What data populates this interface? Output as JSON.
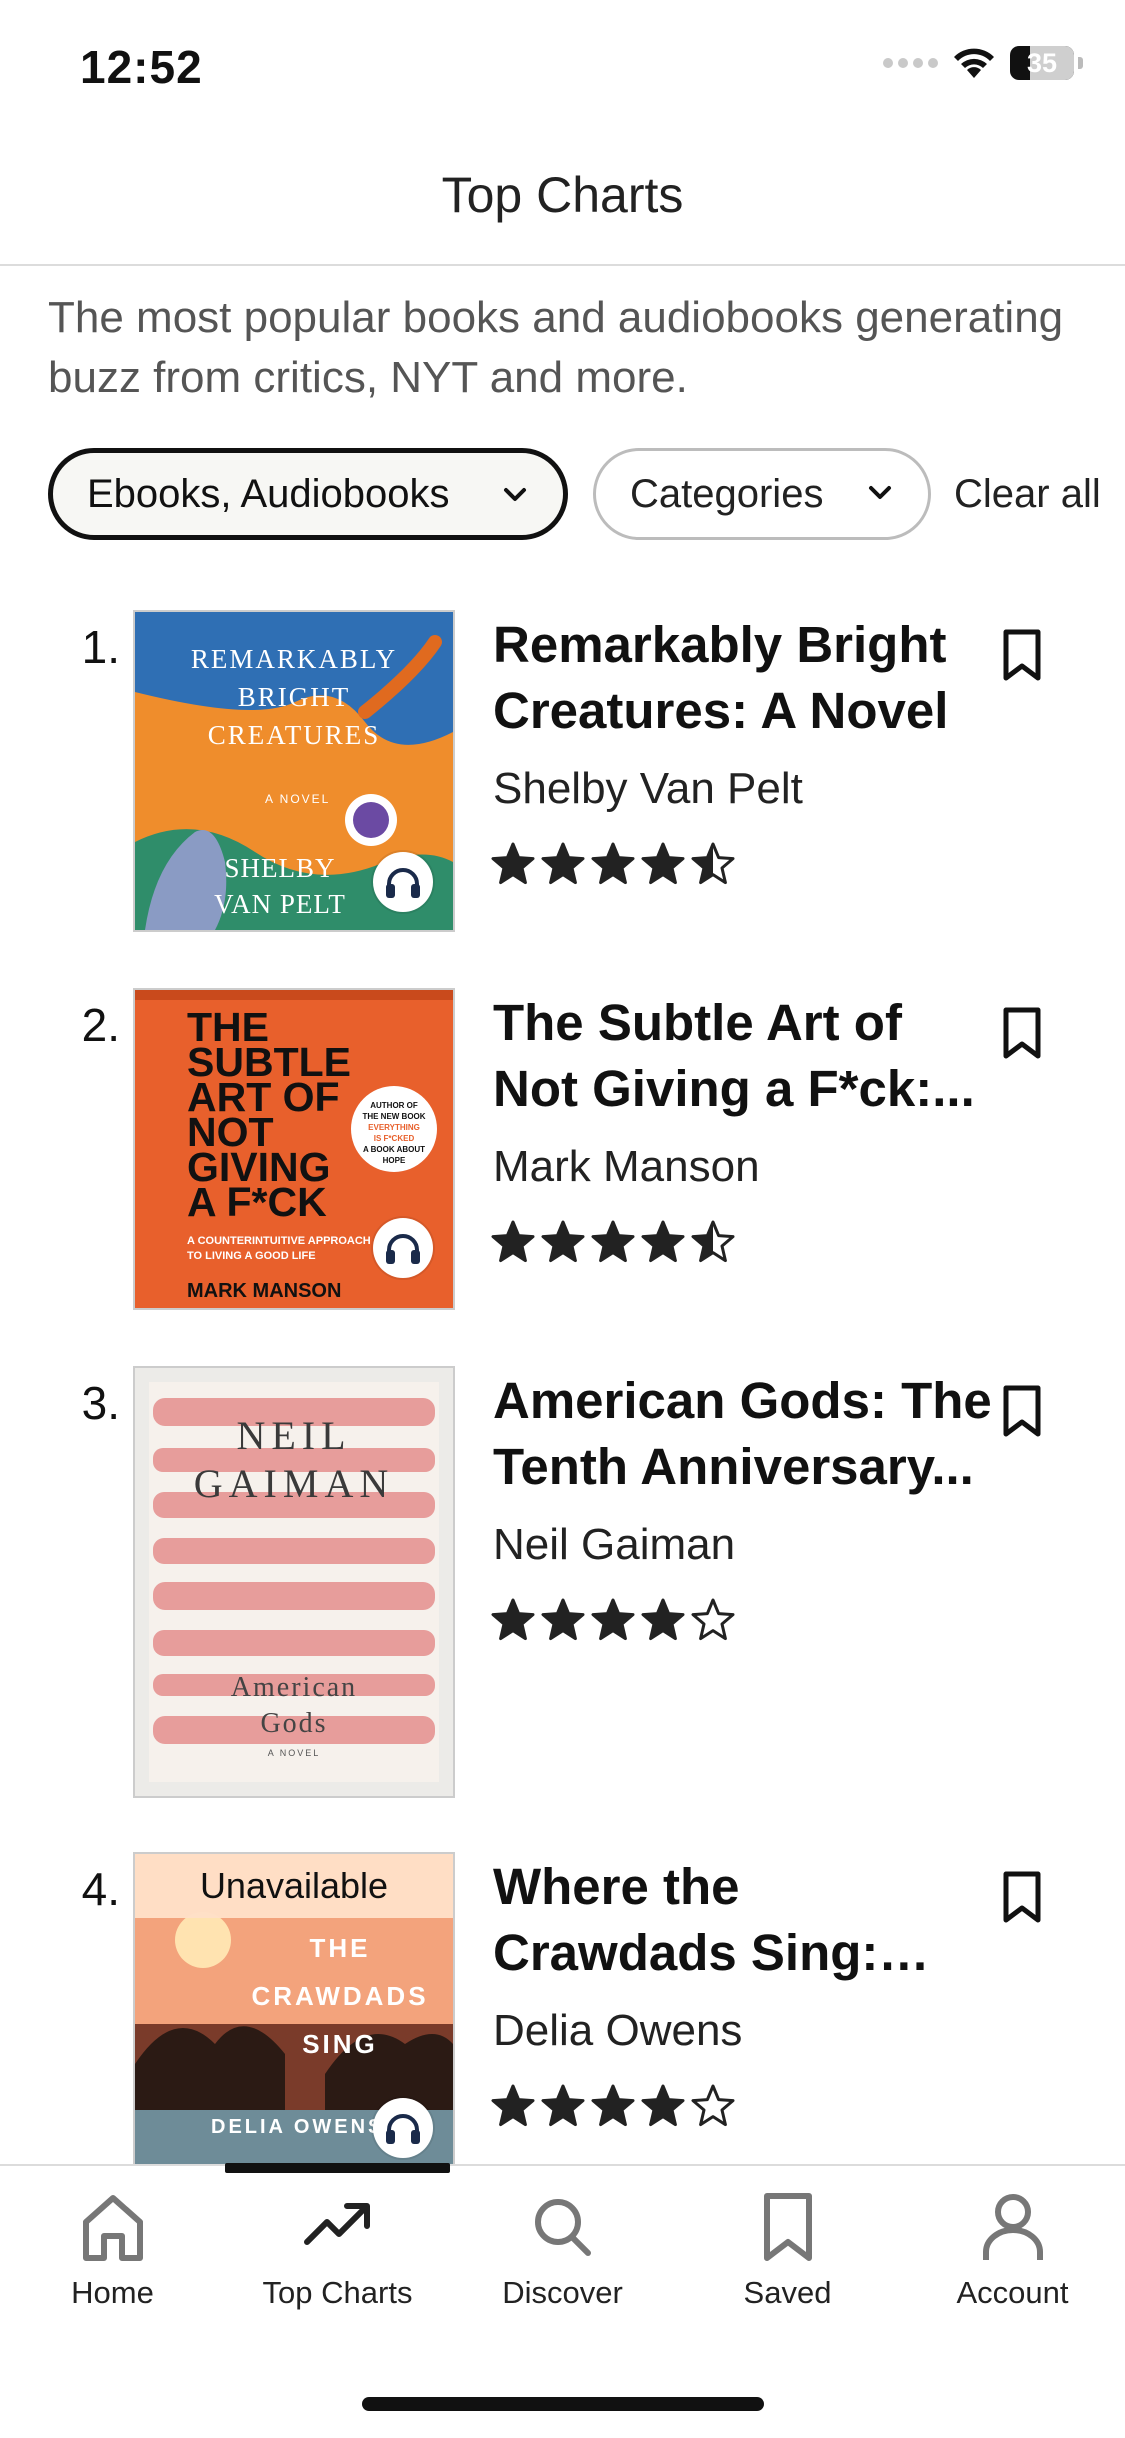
{
  "status_bar": {
    "time": "12:52",
    "battery": "35"
  },
  "header": {
    "title": "Top Charts"
  },
  "intro": {
    "text": "The most popular books and audiobooks generating buzz from critics, NYT and more."
  },
  "filters": {
    "format_label": "Ebooks, Audiobooks",
    "categories_label": "Categories",
    "clear_label": "Clear all"
  },
  "books": [
    {
      "rank": "1.",
      "title": "Remarkably Bright Creatures: A Novel",
      "author": "Shelby Van Pelt",
      "rating": 4.5,
      "audiobook": true,
      "cover": {
        "title_lines": [
          "REMARKABLY",
          "BRIGHT",
          "CREATURES"
        ],
        "tag": "A NOVEL",
        "author_lines": [
          "SHELBY",
          "VAN PELT"
        ]
      }
    },
    {
      "rank": "2.",
      "title": "The Subtle Art of Not Giving a F*ck:...",
      "author": "Mark Manson",
      "rating": 4.5,
      "audiobook": true,
      "cover": {
        "title_lines": [
          "THE",
          "SUBTLE",
          "ART OF",
          "NOT",
          "GIVING",
          "A F*CK"
        ],
        "subtitle": "A COUNTERINTUITIVE APPROACH TO LIVING A GOOD LIFE",
        "author": "MARK MANSON",
        "badge_lines": [
          "AUTHOR OF",
          "THE NEW BOOK",
          "EVERYTHING",
          "IS F*CKED",
          "A BOOK ABOUT",
          "HOPE"
        ]
      }
    },
    {
      "rank": "3.",
      "title": "American Gods: The Tenth Anniversary...",
      "author": "Neil Gaiman",
      "rating": 4,
      "audiobook": false,
      "cover": {
        "author_lines": [
          "NEIL",
          "GAIMAN"
        ],
        "title_lines": [
          "American",
          "Gods"
        ],
        "tag": "A NOVEL"
      }
    },
    {
      "rank": "4.",
      "title": "Where the Crawdads Sing: Reese's Book...",
      "author": "Delia Owens",
      "rating": 4,
      "audiobook": true,
      "unavailable_label": "Unavailable",
      "cover": {
        "title_lines": [
          "THE",
          "CRAWDADS",
          "SING"
        ],
        "author": "DELIA OWENS"
      }
    }
  ],
  "tabs": [
    {
      "label": "Home",
      "icon": "home-icon"
    },
    {
      "label": "Top Charts",
      "icon": "trending-icon"
    },
    {
      "label": "Discover",
      "icon": "search-icon"
    },
    {
      "label": "Saved",
      "icon": "bookmark-icon"
    },
    {
      "label": "Account",
      "icon": "user-icon"
    }
  ],
  "colors": {
    "accent": "#111111",
    "chip_bg": "#f7f7f4",
    "muted_text": "#555555"
  }
}
